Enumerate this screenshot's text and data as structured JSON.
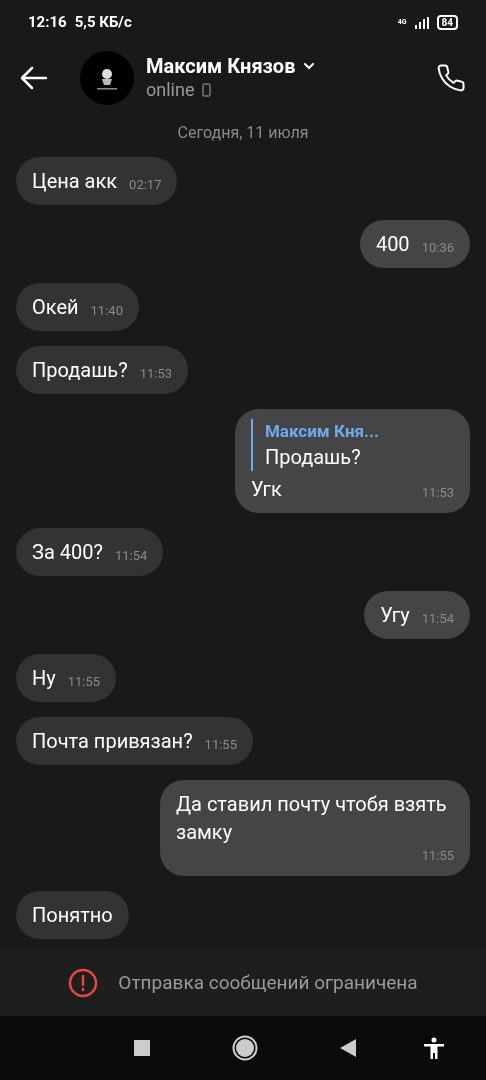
{
  "status_bar": {
    "time": "12:16",
    "speed": "5,5 КБ/с",
    "network": "4G",
    "battery": "84"
  },
  "header": {
    "name": "Максим Князов",
    "status": "online"
  },
  "date": "Сегодня, 11 июля",
  "messages": [
    {
      "outgoing": false,
      "text": "Цена акк",
      "time": "02:17"
    },
    {
      "outgoing": true,
      "text": "400",
      "time": "10:36"
    },
    {
      "outgoing": false,
      "text": "Окей",
      "time": "11:40"
    },
    {
      "outgoing": false,
      "text": "Продашь?",
      "time": "11:53"
    },
    {
      "outgoing": true,
      "reply": {
        "author": "Максим Кня...",
        "text": "Продашь?"
      },
      "text": "Угк",
      "time": "11:53"
    },
    {
      "outgoing": false,
      "text": "За 400?",
      "time": "11:54"
    },
    {
      "outgoing": true,
      "text": "Угу",
      "time": "11:54"
    },
    {
      "outgoing": false,
      "text": "Ну",
      "time": "11:55"
    },
    {
      "outgoing": false,
      "text": "Почта привязан?",
      "time": "11:55"
    },
    {
      "outgoing": true,
      "text": "Да ставил почту чтобя взять замку",
      "time": "11:55"
    },
    {
      "outgoing": false,
      "text": "Понятно"
    }
  ],
  "restriction": "Отправка сообщений ограничена"
}
